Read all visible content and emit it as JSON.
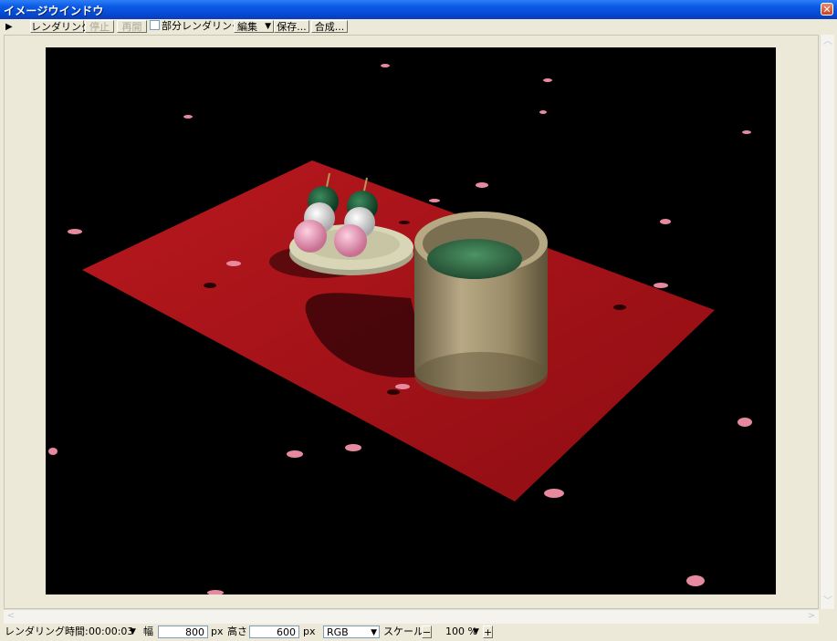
{
  "window": {
    "title": "イメージウインドウ",
    "close_symbol": "✕"
  },
  "toolbar": {
    "play_symbol": "▶",
    "render_label": "レンダリング",
    "stop_label": "停止",
    "resume_label": "再開",
    "partial_render_label": "部分レンダリング",
    "edit_label": "編集",
    "edit_arrow": "▼",
    "save_label": "保存...",
    "composite_label": "合成..."
  },
  "statusbar": {
    "render_time_label": "レンダリング時間:",
    "render_time_value": "00:00:03",
    "render_time_arrow": "▼",
    "width_label": "幅",
    "width_value": "800",
    "width_unit": "px",
    "height_label": "高さ",
    "height_value": "600",
    "height_unit": "px",
    "color_mode": "RGB",
    "color_mode_arrow": "▼",
    "scale_label": "スケール",
    "scale_minus": "−",
    "scale_value": "100 %",
    "scale_arrow": "▼",
    "scale_plus": "+"
  },
  "scroll": {
    "up": "︿",
    "down": "﹀",
    "left": "<",
    "right": ">"
  },
  "render": {
    "description_colors": {
      "background": "#000000",
      "cloth": "#a8141a",
      "plate": "#d9d6b8",
      "cup": "#a89a78",
      "tea": "#3c7a4e",
      "dango_green": "#1d5a38",
      "dango_white": "#e8e8e8",
      "dango_pink": "#e79ab8",
      "petal": "#e78aa0"
    }
  }
}
